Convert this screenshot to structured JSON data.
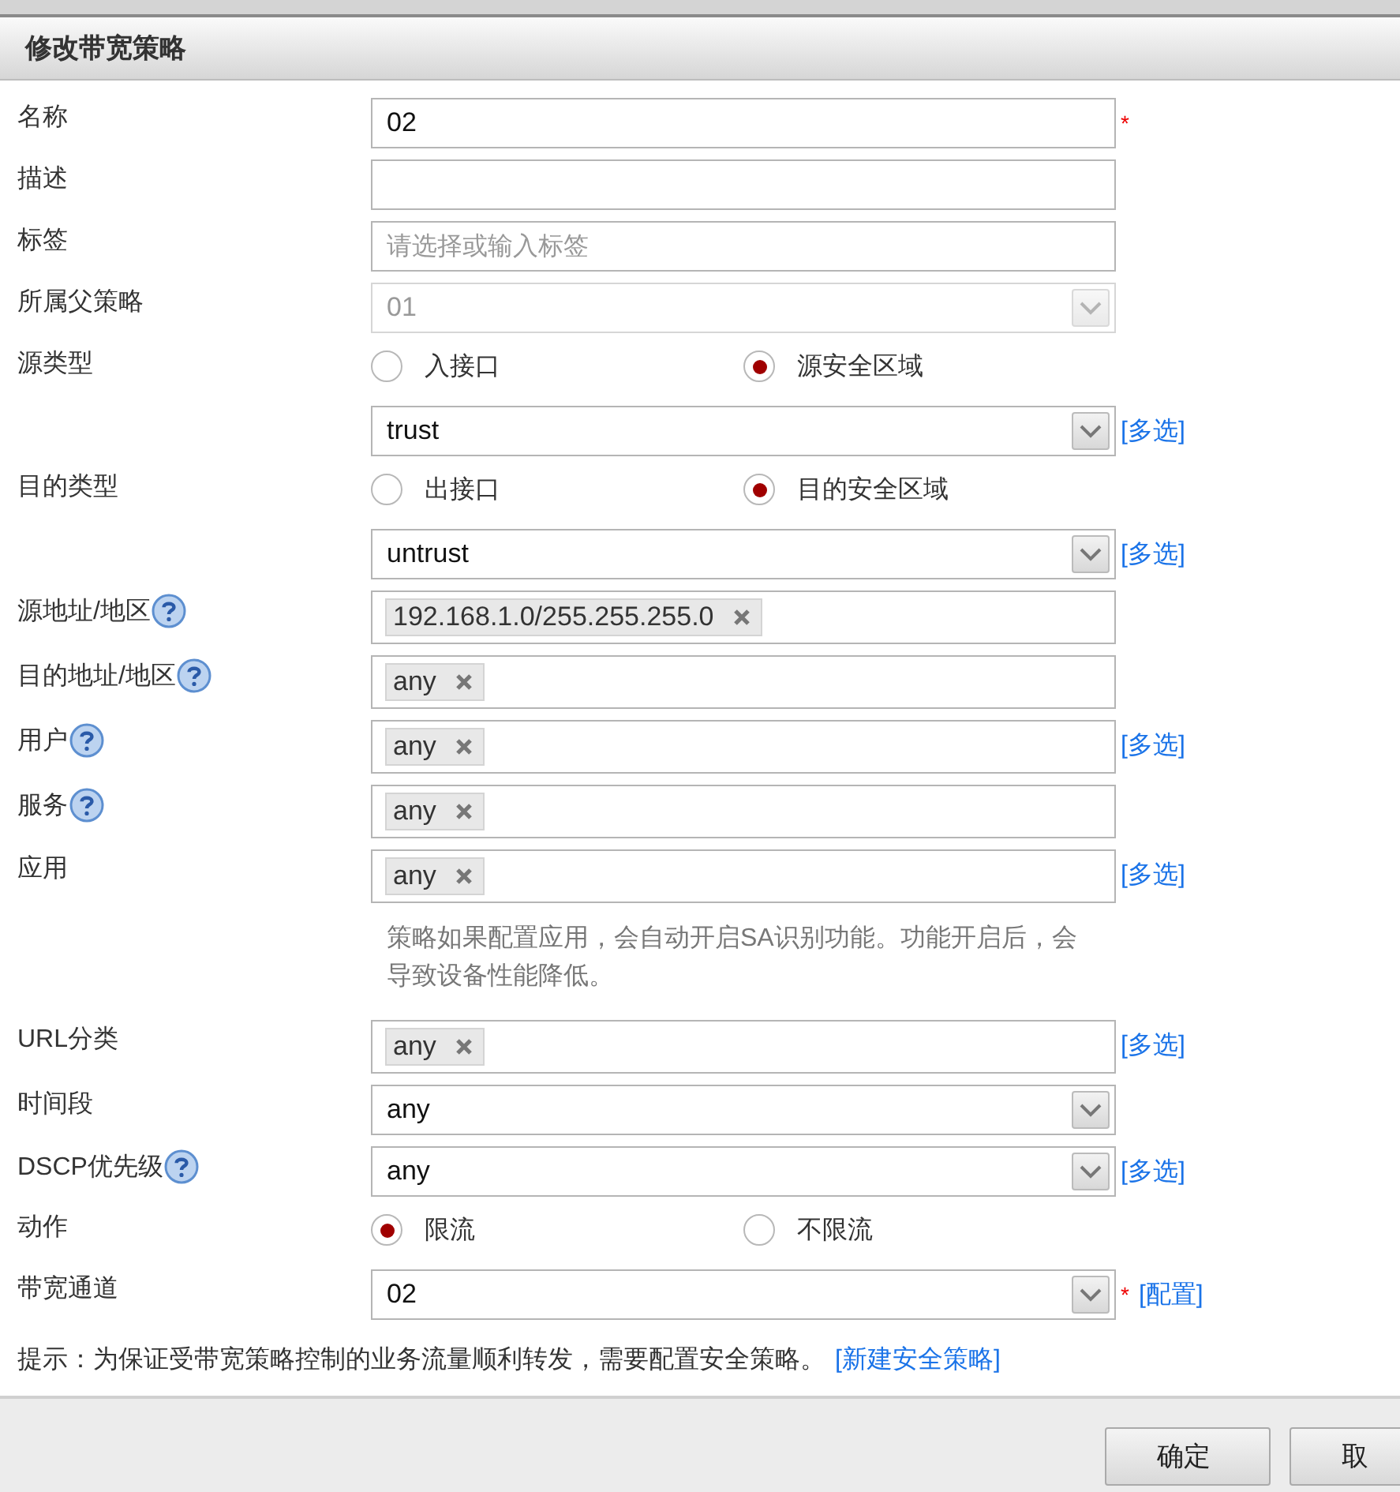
{
  "dialog": {
    "title": "修改带宽策略"
  },
  "rows": [
    {
      "label": "名称",
      "kind": "input",
      "value": "02",
      "required": "*"
    },
    {
      "label": "描述",
      "kind": "input"
    },
    {
      "label": "标签",
      "kind": "input",
      "placeholder": "请选择或输入标签"
    },
    {
      "label": "所属父策略",
      "kind": "select",
      "value": "01",
      "disabled": true
    },
    {
      "label": "源类型",
      "kind": "radio",
      "options": [
        {
          "label": "入接口",
          "selected": false
        },
        {
          "label": "源安全区域",
          "selected": true
        }
      ]
    },
    {
      "kind": "select",
      "value": "trust",
      "disabled": false,
      "link": "[多选]"
    },
    {
      "label": "目的类型",
      "kind": "radio",
      "options": [
        {
          "label": "出接口",
          "selected": false
        },
        {
          "label": "目的安全区域",
          "selected": true
        }
      ]
    },
    {
      "kind": "select",
      "value": "untrust",
      "disabled": false,
      "link": "[多选]"
    },
    {
      "label": "源地址/地区",
      "help": true,
      "kind": "tags",
      "tags": [
        "192.168.1.0/255.255.255.0"
      ]
    },
    {
      "label": "目的地址/地区",
      "help": true,
      "kind": "tags",
      "tags": [
        "any"
      ]
    },
    {
      "label": "用户",
      "help": true,
      "kind": "tags",
      "tags": [
        "any"
      ],
      "link": "[多选]"
    },
    {
      "label": "服务",
      "help": true,
      "kind": "tags",
      "tags": [
        "any"
      ]
    },
    {
      "label": "应用",
      "kind": "tags",
      "tags": [
        "any"
      ],
      "link": "[多选]"
    },
    {
      "kind": "note",
      "text": "策略如果配置应用，会自动开启SA识别功能。功能开启后，会导致设备性能降低。"
    },
    {
      "label": "URL分类",
      "kind": "tags",
      "tags": [
        "any"
      ],
      "link": "[多选]"
    },
    {
      "label": "时间段",
      "kind": "select",
      "value": "any",
      "disabled": false
    },
    {
      "label": "DSCP优先级",
      "help": true,
      "kind": "select",
      "value": "any",
      "disabled": false,
      "link": "[多选]"
    },
    {
      "label": "动作",
      "kind": "radio",
      "options": [
        {
          "label": "限流",
          "selected": true
        },
        {
          "label": "不限流",
          "selected": false
        }
      ]
    },
    {
      "label": "带宽通道",
      "kind": "select",
      "value": "02",
      "disabled": false,
      "required": "*",
      "link": "[配置]"
    }
  ],
  "hint": {
    "text": "提示：为保证受带宽策略控制的业务流量顺利转发，需要配置安全策略。",
    "link": "[新建安全策略]"
  },
  "buttons": [
    "确定",
    "取"
  ]
}
